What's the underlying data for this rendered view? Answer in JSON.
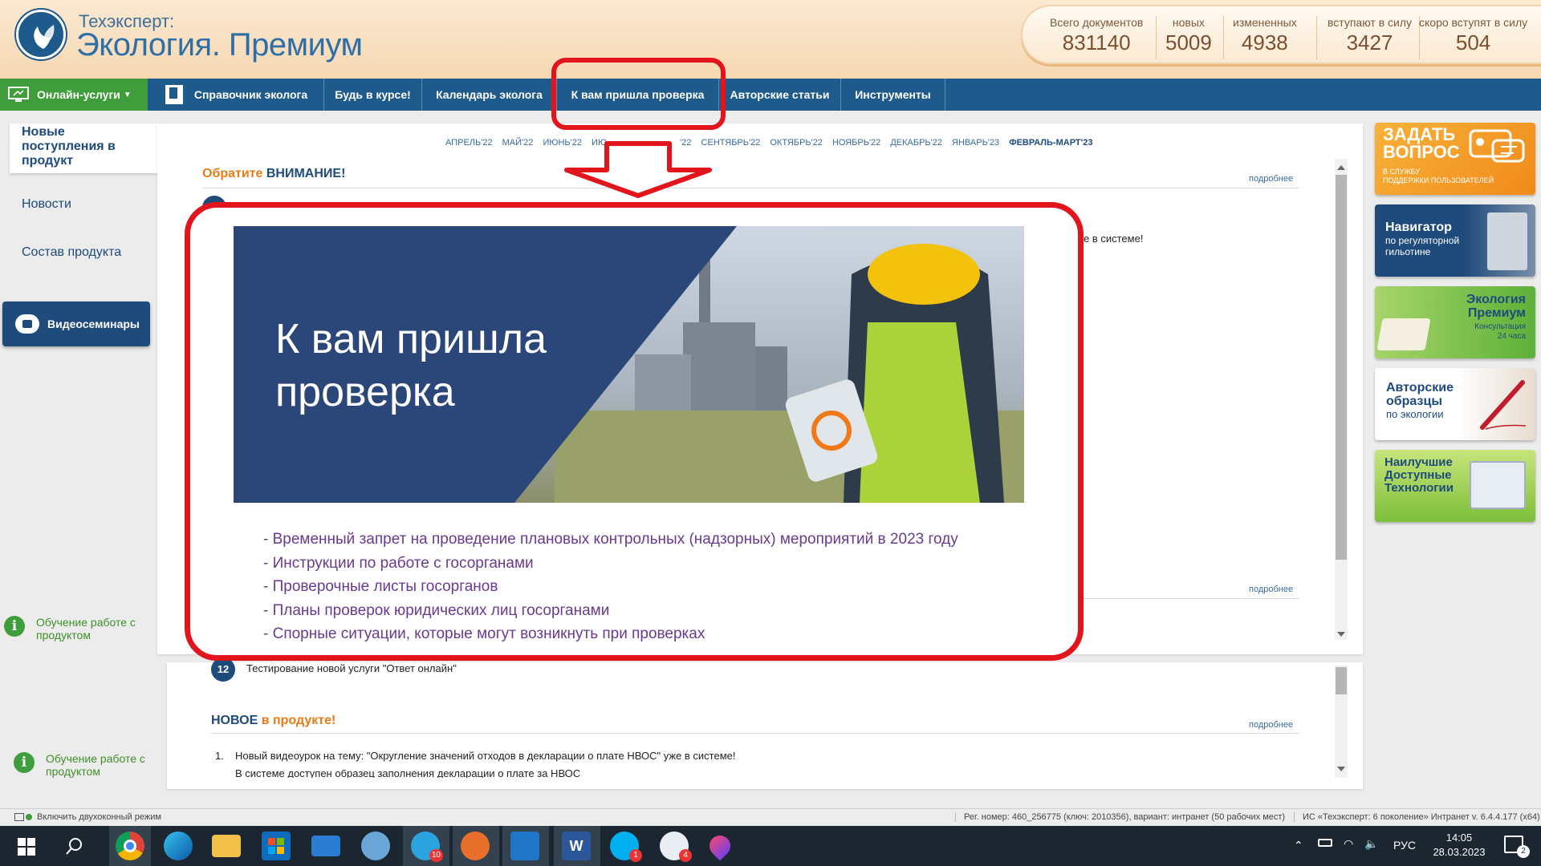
{
  "header": {
    "brand_top": "Техэксперт:",
    "brand_main": "Экология. Премиум",
    "stats": [
      {
        "label": "Всего документов",
        "value": "831140"
      },
      {
        "label": "новых",
        "value": "5009"
      },
      {
        "label": "измененных",
        "value": "4938"
      },
      {
        "label": "вступают в силу",
        "value": "3427"
      },
      {
        "label": "скоро вступят в силу",
        "value": "504"
      }
    ]
  },
  "nav": {
    "online": "Онлайн-услуги",
    "items": [
      "Справочник эколога",
      "Будь в курсе!",
      "Календарь эколога",
      "К вам пришла проверка",
      "Авторские статьи",
      "Инструменты"
    ]
  },
  "sidebar": {
    "new_arrivals": "Новые поступления в продукт",
    "news": "Новости",
    "composition": "Состав продукта",
    "webinars": "Видеосеминары",
    "learn1": "Обучение работе с продуктом",
    "learn2": "Обучение работе с продуктом"
  },
  "main": {
    "months": [
      "АПРЕЛЬ'22",
      "МАЙ'22",
      "ИЮНЬ'22",
      "ИЮ",
      "'22",
      "СЕНТЯБРЬ'22",
      "ОКТЯБРЬ'22",
      "НОЯБРЬ'22",
      "ДЕКАБРЬ'22",
      "ЯНВАРЬ'23",
      "ФЕВРАЛЬ-МАРТ'23"
    ],
    "attention_a": "Обратите",
    "attention_b": "ВНИМАНИЕ!",
    "more": "подробнее",
    "peek_text": "е в системе!",
    "item12_num": "12",
    "item12_text": "Тестирование новой услуги \"Ответ онлайн\"",
    "new_a": "НОВОЕ",
    "new_b": "в продукте!",
    "new_item1_num": "1.",
    "new_item1": "Новый видеоурок на тему: \"Округление значений отходов в декларации о плате НВОС\" уже в системе!",
    "new_item2_partial": "В системе доступен образец заполнения декларации о плате за НВОС"
  },
  "banners": {
    "ask": {
      "line1": "ЗАДАТЬ",
      "line2": "ВОПРОС",
      "sub1": "В СЛУЖБУ",
      "sub2": "ПОДДЕРЖКИ ПОЛЬЗОВАТЕЛЕЙ"
    },
    "navigator": {
      "title": "Навигатор",
      "sub1": "по регуляторной",
      "sub2": "гильотине"
    },
    "ecology": {
      "line1": "Экология",
      "line2": "Премиум",
      "sub1": "Консультация",
      "sub2": "24 часа"
    },
    "samples": {
      "line1": "Авторские",
      "line2": "образцы",
      "sub": "по экологии"
    },
    "ndt": {
      "line1": "Наилучшие",
      "line2": "Доступные",
      "line3": "Технологии"
    }
  },
  "popup": {
    "title_line1": "К вам пришла",
    "title_line2": "проверка",
    "list": [
      "- Временный запрет на проведение плановых контрольных (надзорных) мероприятий в 2023 году",
      "- Инструкции по работе с госорганами",
      "- Проверочные листы госорганов",
      "- Планы проверок юридических лиц госорганами",
      "- Спорные ситуации, которые могут возникнуть при проверках"
    ]
  },
  "status": {
    "dual_mode": "Включить двухоконный режим",
    "reg": "Рег. номер: 460_256775 (ключ: 2010356), вариант: интранет (50 рабочих мест)",
    "version": "ИС «Техэксперт: 6 поколение» Интранет v. 6.4.4.177 (x64)"
  },
  "taskbar": {
    "lang": "РУС",
    "time": "14:05",
    "date": "28.03.2023",
    "badges": {
      "telegram": "10",
      "skype": "1",
      "mail": "4",
      "notif": "2"
    }
  },
  "colors": {
    "navy": "#1e5a8c",
    "green": "#3f9d3b",
    "orange": "#ea7a14",
    "highlight": "#e2141c"
  }
}
